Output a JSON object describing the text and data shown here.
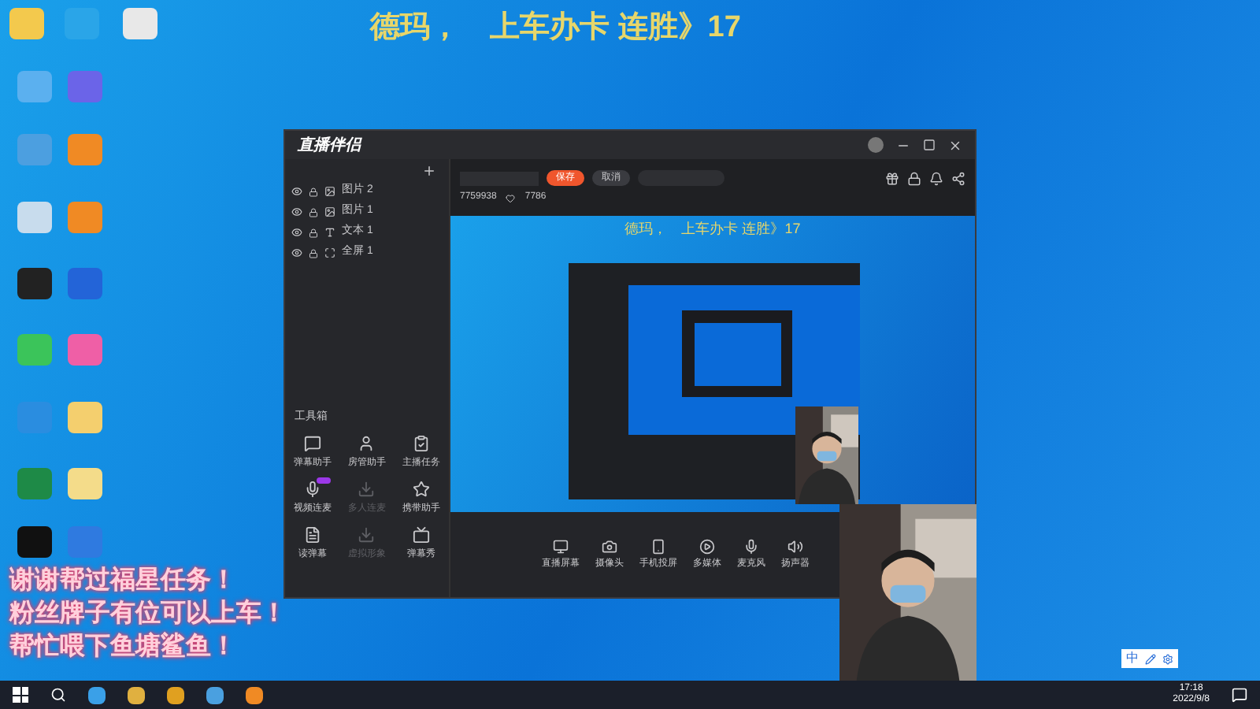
{
  "stream_title_overlay": "德玛，　上车办卡 连胜》17",
  "app": {
    "logo": "直播伴侣",
    "layers": [
      {
        "label": "图片 2"
      },
      {
        "label": "图片 1"
      },
      {
        "label": "文本 1"
      },
      {
        "label": "全屏 1"
      }
    ],
    "toolbox_title": "工具箱",
    "tools": [
      {
        "label": "弹幕助手",
        "disabled": false,
        "badge": false
      },
      {
        "label": "房管助手",
        "disabled": false,
        "badge": false
      },
      {
        "label": "主播任务",
        "disabled": false,
        "badge": false
      },
      {
        "label": "视频连麦",
        "disabled": false,
        "badge": true
      },
      {
        "label": "多人连麦",
        "disabled": true,
        "badge": false
      },
      {
        "label": "携带助手",
        "disabled": false,
        "badge": false
      },
      {
        "label": "读弹幕",
        "disabled": false,
        "badge": false
      },
      {
        "label": "虚拟形象",
        "disabled": true,
        "badge": false
      },
      {
        "label": "弹幕秀",
        "disabled": false,
        "badge": false
      }
    ],
    "save_button": "保存",
    "cancel_button": "取消",
    "room_id": "7759938",
    "likes": "7786",
    "preview_title": "德玛，　上车办卡 连胜》17",
    "sources": [
      {
        "label": "直播屏幕"
      },
      {
        "label": "摄像头"
      },
      {
        "label": "手机投屏"
      },
      {
        "label": "多媒体"
      },
      {
        "label": "麦克风"
      },
      {
        "label": "扬声器"
      }
    ]
  },
  "caption_lines": [
    "谢谢帮过福星任务！",
    "粉丝牌子有位可以上车！",
    "帮忙喂下鱼塘鲨鱼！"
  ],
  "ime_bar": {
    "mode": "中"
  },
  "clock": {
    "time": "17:18",
    "date": "2022/9/8"
  }
}
